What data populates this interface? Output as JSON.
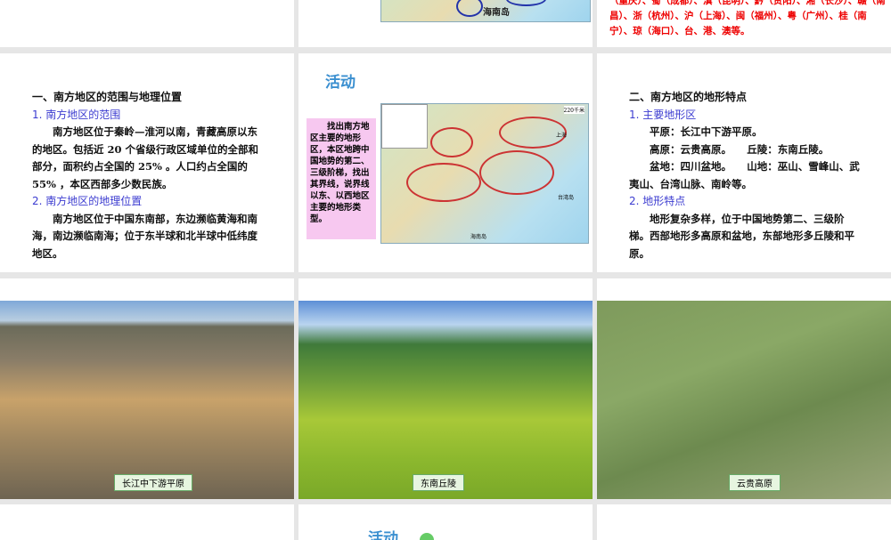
{
  "slides": {
    "top_right": {
      "text": "（重庆）、蜀（成都）、滇（昆明）、黔（贵阳）、湘（长沙）、赣（南昌）、浙（杭州）、沪（上海）、闽（福州）、粤（广州）、桂（南宁）、琼（海口）、台、港、澳等。"
    },
    "top_middle": {
      "map_label": "海南岛"
    },
    "scope": {
      "title": "一、南方地区的范围与地理位置",
      "sub1": "1. 南方地区的范围",
      "p1": "南方地区位于秦岭—淮河以南，青藏高原以东的地区。包括近 20 个省级行政区域单位的全部和部分，面积约占全国的 25% 。人口约占全国的 55% ，本区西部多少数民族。",
      "sub2": "2. 南方地区的地理位置",
      "p2": "南方地区位于中国东南部，东边濒临黄海和南海，南边濒临南海；位于东半球和北半球中低纬度地区。"
    },
    "activity": {
      "title": "活动",
      "text": "找出南方地区主要的地形区，本区地跨中国地势的第二、三级阶梯，找出其界线，说界线以东、以西地区主要的地形类型。",
      "scale": "220千米",
      "map_labels": [
        "上海",
        "台湾岛",
        "海南岛"
      ]
    },
    "terrain": {
      "title": "二、南方地区的地形特点",
      "sub1": "1. 主要地形区",
      "l1": "平原：长江中下游平原。",
      "l2a": "高原：云贵高原。",
      "l2b": "丘陵：东南丘陵。",
      "l3": "盆地：四川盆地。　　山地：巫山、雪峰山、武夷山、台湾山脉、南岭等。",
      "sub2": "2. 地形特点",
      "p2": "地形复杂多样，位于中国地势第二、三级阶梯。西部地形多高原和盆地，东部地形多丘陵和平原。"
    },
    "photos": [
      {
        "caption": "长江中下游平原"
      },
      {
        "caption": "东南丘陵"
      },
      {
        "caption": "云贵高原"
      }
    ],
    "bottom_middle": {
      "title": "活动"
    }
  }
}
